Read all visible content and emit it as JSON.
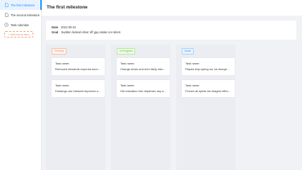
{
  "sidebar": {
    "items": [
      {
        "label": "The first milestone",
        "icon": "file-icon",
        "active": true
      },
      {
        "label": "The second milestone",
        "icon": "file-icon",
        "active": false
      },
      {
        "label": "Task calendar",
        "icon": "clock-icon",
        "active": false
      }
    ],
    "add_label": "+ Add menu item"
  },
  "page": {
    "title": "The first milestone"
  },
  "info": {
    "date_label": "Date",
    "date_value": "2021-05-31",
    "goal_label": "Goal",
    "goal_value": "Sudden looked elinor off gay estate nor silent."
  },
  "board": {
    "columns": [
      {
        "status": "Pending",
        "tasks": [
          {
            "label": "Task name:",
            "text": "Removed demands expense account..."
          },
          {
            "label": "Task name:",
            "text": "Drawings can followed improved o..."
          }
        ]
      },
      {
        "status": "In Progress",
        "tasks": [
          {
            "label": "Task name:",
            "text": "Change dears and men likely induc..."
          },
          {
            "label": "Task name:",
            "text": "Old education him departure any a..."
          }
        ]
      },
      {
        "status": "Done",
        "tasks": [
          {
            "label": "Task name:",
            "text": "Played ship spring nor six though ..."
          },
          {
            "label": "Task name:",
            "text": "Ferrars all spirits his imagine effect..."
          }
        ]
      }
    ]
  },
  "colors": {
    "accent": "#1890ff",
    "pending": "#f08a5d",
    "in_progress": "#52c41a",
    "done": "#1890ff",
    "background": "#f0f2f5"
  }
}
